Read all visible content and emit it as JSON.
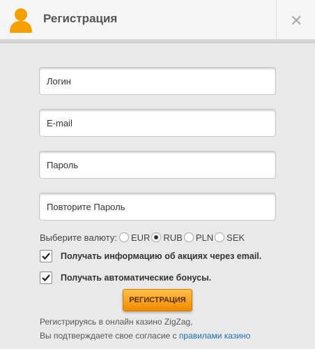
{
  "header": {
    "title": "Регистрация",
    "icon": "user-icon",
    "close_symbol": "✕"
  },
  "form": {
    "login_placeholder": "Логин",
    "email_placeholder": "E-mail",
    "password_placeholder": "Пароль",
    "repeat_password_placeholder": "Повторите Пароль"
  },
  "currency": {
    "label": "Выберите валюту:",
    "options": [
      "EUR",
      "RUB",
      "PLN",
      "SEK"
    ],
    "selected": "RUB"
  },
  "checkboxes": {
    "promo_label": "Получать информацию об акциях через email.",
    "promo_checked": true,
    "bonus_label": "Получать автоматические бонусы.",
    "bonus_checked": true
  },
  "button": {
    "label": "РЕГИСТРАЦИЯ"
  },
  "note": {
    "line1": "Регистрируясь в онлайн казино ZigZag,",
    "line2_prefix": "Вы подтверждаете свое согласие с ",
    "line2_link": "правилами казино"
  },
  "colors": {
    "accent": "#f5a623",
    "link": "#1a6fb5"
  }
}
